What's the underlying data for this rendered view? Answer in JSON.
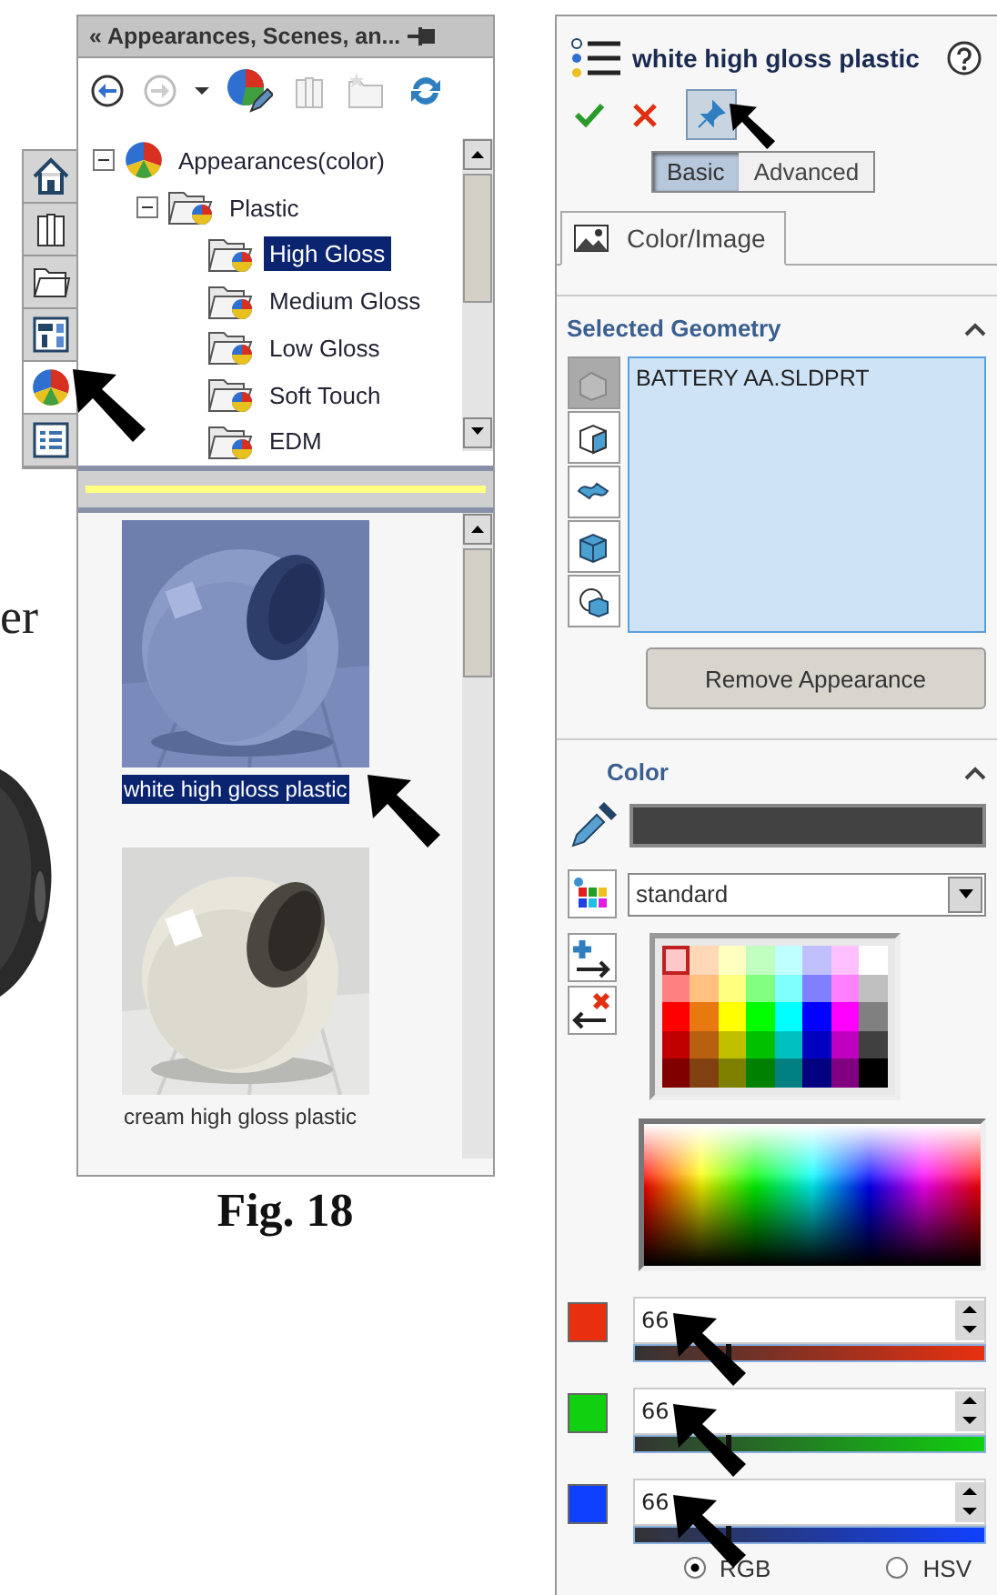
{
  "stray_text": "er",
  "side_tabs": [
    {
      "kind": "home",
      "selected": false
    },
    {
      "kind": "library",
      "selected": false
    },
    {
      "kind": "folder",
      "selected": false
    },
    {
      "kind": "layout",
      "selected": false
    },
    {
      "kind": "appearance",
      "selected": true
    },
    {
      "kind": "list",
      "selected": false
    }
  ],
  "left_panel": {
    "title": "« Appearances, Scenes, an...",
    "tree": [
      {
        "label": "Appearances(color)",
        "expanded": true,
        "children": [
          {
            "label": "Plastic",
            "expanded": true,
            "children": [
              {
                "label": "High Gloss",
                "selected": true
              },
              {
                "label": "Medium Gloss",
                "selected": false
              },
              {
                "label": "Low Gloss",
                "selected": false
              },
              {
                "label": "Soft Touch",
                "selected": false
              },
              {
                "label": "EDM",
                "selected": false
              }
            ]
          }
        ]
      }
    ],
    "thumbnails": [
      {
        "label": "white high gloss plastic",
        "selected": true
      },
      {
        "label": "cream high gloss plastic",
        "selected": false
      }
    ]
  },
  "caption": "Fig. 18",
  "right_panel": {
    "title": "white high gloss plastic",
    "modes": [
      {
        "label": "Basic",
        "selected": true
      },
      {
        "label": "Advanced",
        "selected": false
      }
    ],
    "tabs": [
      {
        "label": "Color/Image",
        "selected": true
      }
    ],
    "geometry": {
      "heading": "Selected Geometry",
      "expanded": true,
      "items": [
        "BATTERY AA.SLDPRT"
      ],
      "button": "Remove Appearance"
    },
    "color": {
      "heading": "Color",
      "expanded": true,
      "palette_set": "standard",
      "palette": [
        [
          {
            "color": "#ffc8c8",
            "selected": true
          },
          {
            "color": "#ffd8b8",
            "selected": false
          },
          {
            "color": "#ffffc0",
            "selected": false
          },
          {
            "color": "#c0ffc0",
            "selected": false
          },
          {
            "color": "#c0ffff",
            "selected": false
          },
          {
            "color": "#c0c0ff",
            "selected": false
          },
          {
            "color": "#ffc0ff",
            "selected": false
          },
          {
            "color": "#ffffff",
            "selected": false
          }
        ],
        [
          {
            "color": "#ff8080",
            "selected": false
          },
          {
            "color": "#ffc080",
            "selected": false
          },
          {
            "color": "#ffff80",
            "selected": false
          },
          {
            "color": "#80ff80",
            "selected": false
          },
          {
            "color": "#80ffff",
            "selected": false
          },
          {
            "color": "#8080ff",
            "selected": false
          },
          {
            "color": "#ff80ff",
            "selected": false
          },
          {
            "color": "#c0c0c0",
            "selected": false
          }
        ],
        [
          {
            "color": "#ff0000",
            "selected": false
          },
          {
            "color": "#e87810",
            "selected": false
          },
          {
            "color": "#ffff00",
            "selected": false
          },
          {
            "color": "#00ff00",
            "selected": false
          },
          {
            "color": "#00ffff",
            "selected": false
          },
          {
            "color": "#0000ff",
            "selected": false
          },
          {
            "color": "#ff00ff",
            "selected": false
          },
          {
            "color": "#808080",
            "selected": false
          }
        ],
        [
          {
            "color": "#c00000",
            "selected": false
          },
          {
            "color": "#b86010",
            "selected": false
          },
          {
            "color": "#c0c000",
            "selected": false
          },
          {
            "color": "#00c000",
            "selected": false
          },
          {
            "color": "#00c0c0",
            "selected": false
          },
          {
            "color": "#0000c0",
            "selected": false
          },
          {
            "color": "#c000c0",
            "selected": false
          },
          {
            "color": "#404040",
            "selected": false
          }
        ],
        [
          {
            "color": "#800000",
            "selected": false
          },
          {
            "color": "#804010",
            "selected": false
          },
          {
            "color": "#808000",
            "selected": false
          },
          {
            "color": "#008000",
            "selected": false
          },
          {
            "color": "#008080",
            "selected": false
          },
          {
            "color": "#000080",
            "selected": false
          },
          {
            "color": "#800080",
            "selected": false
          },
          {
            "color": "#000000",
            "selected": false
          }
        ]
      ],
      "channels": [
        {
          "value": "66",
          "color": "#e83010",
          "level": 0.26
        },
        {
          "value": "66",
          "color": "#10d010",
          "level": 0.26
        },
        {
          "value": "66",
          "color": "#1040ff",
          "level": 0.26
        }
      ],
      "models": [
        {
          "label": "RGB",
          "selected": true
        },
        {
          "label": "HSV",
          "selected": false
        }
      ]
    }
  }
}
